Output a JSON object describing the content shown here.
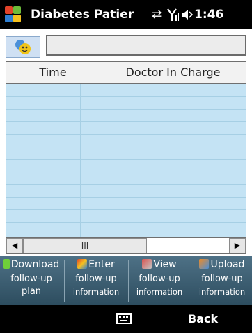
{
  "status_bar": {
    "title": "Diabetes Patier",
    "sync_icon": "⇄",
    "signal_icon": "Y",
    "volume_icon": "◀",
    "time": "1:46"
  },
  "search": {
    "value": "",
    "placeholder": ""
  },
  "table": {
    "columns": [
      "Time",
      "Doctor In Charge"
    ],
    "rows": []
  },
  "scrollbar": {
    "thumb_label": "III",
    "left_arrow": "◀",
    "right_arrow": "▶"
  },
  "toolbar": {
    "buttons": [
      {
        "line1": "Download",
        "line2": "follow-up",
        "line3": "plan",
        "icon": "download-icon"
      },
      {
        "line1": "Enter",
        "line2": "follow-up",
        "line3": "information",
        "icon": "enter-icon"
      },
      {
        "line1": "View",
        "line2": "follow-up",
        "line3": "information",
        "icon": "view-icon"
      },
      {
        "line1": "Upload",
        "line2": "follow-up",
        "line3": "information",
        "icon": "upload-icon"
      }
    ]
  },
  "softkeys": {
    "right": "Back"
  }
}
